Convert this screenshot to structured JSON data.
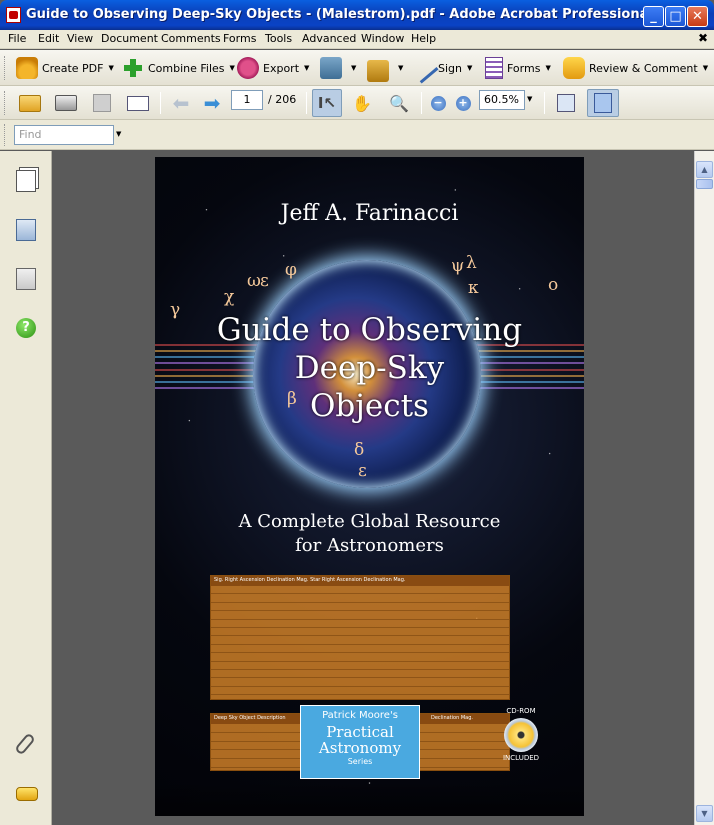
{
  "window": {
    "title": "Guide to Observing Deep-Sky Objects - (Malestrom).pdf - Adobe Acrobat Professional",
    "min_label": "_",
    "max_label": "□",
    "close_label": "✕",
    "doc_close_label": "✖"
  },
  "menubar": {
    "items": [
      "File",
      "Edit",
      "View",
      "Document",
      "Comments",
      "Forms",
      "Tools",
      "Advanced",
      "Window",
      "Help"
    ]
  },
  "toolbar": {
    "create_pdf": "Create PDF",
    "combine_files": "Combine Files",
    "export": "Export",
    "sign": "Sign",
    "forms": "Forms",
    "review_comment": "Review & Comment"
  },
  "navigation": {
    "current_page": "1",
    "page_count": "/ 206",
    "zoom": "60.5%",
    "zoom_out_label": "−",
    "zoom_in_label": "+"
  },
  "find": {
    "placeholder": "Find"
  },
  "cover": {
    "author": "Jeff A. Farinacci",
    "title_line1": "Guide to Observing",
    "title_line2": "Deep-Sky",
    "title_line3": "Objects",
    "subtitle_line1": "A Complete Global Resource",
    "subtitle_line2": "for Astronomers",
    "greek_letters": [
      "ω",
      "ε",
      "φ",
      "χ",
      "γ",
      "ψ",
      "λ",
      "κ",
      "ο",
      "β",
      "δ",
      "ε"
    ],
    "table_header_1": "Sig.   Right Ascension    Declination    Mag.   Star   Right Ascension    Declination    Mag.",
    "table_header_2": "Deep Sky Object   Description",
    "table_header_3": "Declination   Mag.",
    "series_publisher": "Patrick Moore's",
    "series_line1": "Practical",
    "series_line2": "Astronomy",
    "series_label": "Series",
    "cd_label": "CD-ROM",
    "cd_included": "INCLUDED"
  },
  "icons": {
    "nav_pages": "pages-icon",
    "nav_bookmarks": "bookmarks-icon",
    "nav_signatures": "signatures-icon",
    "nav_help": "help-icon",
    "nav_attachments": "paperclip-icon",
    "nav_comments": "comments-icon"
  }
}
